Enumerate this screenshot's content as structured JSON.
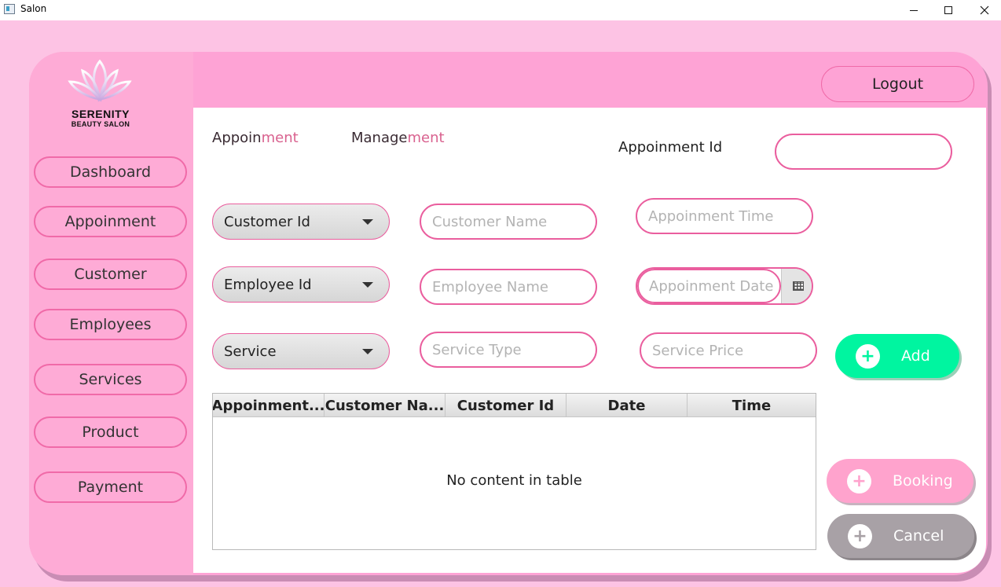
{
  "window": {
    "title": "Salon",
    "controls": [
      "minimize",
      "maximize",
      "close"
    ]
  },
  "brand": {
    "name": "SERENITY",
    "subtitle": "BEAUTY SALON",
    "logo_icon": "lotus-icon"
  },
  "sidebar": {
    "items": [
      {
        "label": "Dashboard"
      },
      {
        "label": "Appoinment"
      },
      {
        "label": "Customer"
      },
      {
        "label": "Employees"
      },
      {
        "label": "Services"
      },
      {
        "label": "Product"
      },
      {
        "label": "Payment"
      }
    ]
  },
  "header": {
    "logout_label": "Logout"
  },
  "content": {
    "heading_left": {
      "dark": "Appoin",
      "pink": "ment"
    },
    "heading_right": {
      "dark": "Manage",
      "pink": "ment"
    },
    "appointment_id_label": "Appoinment Id",
    "appointment_id_value": "",
    "combos": {
      "customer_id": "Customer Id",
      "employee_id": "Employee Id",
      "service": "Service"
    },
    "placeholders": {
      "customer_name": "Customer Name",
      "employee_name": "Employee Name",
      "service_type": "Service Type",
      "appointment_time": "Appoinment Time",
      "appointment_date": "Appoinment Date",
      "service_price": "Service Price"
    },
    "buttons": {
      "add": "Add",
      "booking": "Booking",
      "cancel": "Cancel",
      "plus_symbol": "+"
    },
    "table": {
      "columns": [
        "Appoinment...",
        "Customer Na...",
        "Customer Id",
        "Date",
        "Time"
      ],
      "rows": [],
      "empty_message": "No content in table"
    }
  },
  "colors": {
    "background": "#fdc3e4",
    "card": "#fea3d5",
    "accent_border": "#ea5e9e",
    "add": "#00f5a0",
    "booking": "#ffa3cd",
    "cancel": "#a8a1a6"
  }
}
